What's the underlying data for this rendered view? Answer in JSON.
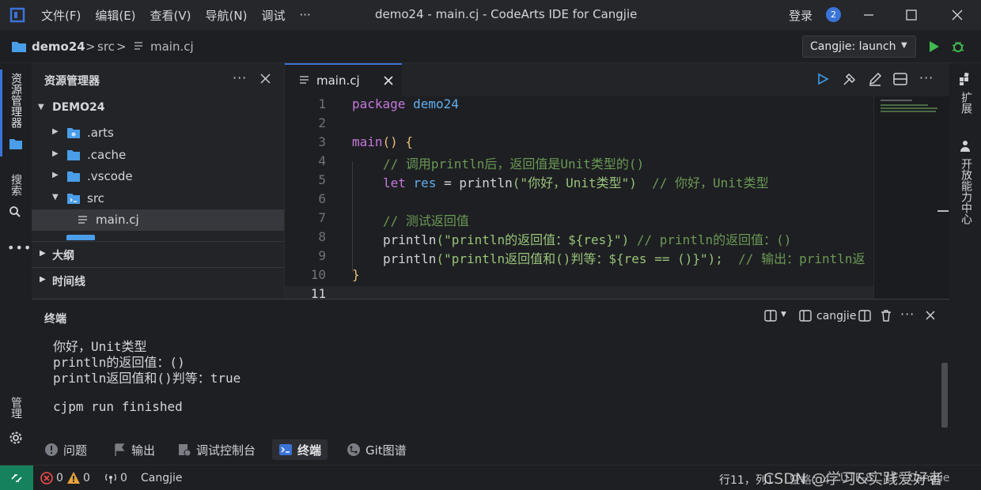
{
  "titlebar": {
    "menus": [
      "文件(F)",
      "编辑(E)",
      "查看(V)",
      "导航(N)",
      "调试",
      "···"
    ],
    "title": "demo24 - main.cj - CodeArts IDE for Cangjie",
    "login": "登录",
    "notification_count": "2"
  },
  "breadcrumb": {
    "project": "demo24",
    "folder": "src",
    "file": "main.cj",
    "sep": ">"
  },
  "launch": {
    "config": "Cangjie: launch"
  },
  "activity": {
    "explorer": "资源管理器",
    "search": "搜索",
    "manage": "管理"
  },
  "sidebar": {
    "title": "资源管理器",
    "root": "DEMO24",
    "items": [
      {
        "label": ".arts"
      },
      {
        "label": ".cache"
      },
      {
        "label": ".vscode"
      },
      {
        "label": "src"
      },
      {
        "label": "main.cj"
      }
    ],
    "outline": "大纲",
    "timeline": "时间线"
  },
  "editor": {
    "tab": "main.cj",
    "lines": [
      {
        "n": "1"
      },
      {
        "n": "2"
      },
      {
        "n": "3"
      },
      {
        "n": "4"
      },
      {
        "n": "5"
      },
      {
        "n": "6"
      },
      {
        "n": "7"
      },
      {
        "n": "8"
      },
      {
        "n": "9"
      },
      {
        "n": "10"
      },
      {
        "n": "11"
      }
    ],
    "code": {
      "l1_kw": "package",
      "l1_name": "demo24",
      "l3_fn": "main",
      "l3_rest": "() {",
      "l4": "// 调用println后，返回值是Unit类型的()",
      "l5_kw": "let",
      "l5_var": "res",
      "l5_eq": " = ",
      "l5_fn": "println",
      "l5_str": "(\"你好，Unit类型\")",
      "l5_cmt": "// 你好，Unit类型",
      "l7": "// 测试返回值",
      "l8_fn": "println",
      "l8_str": "(\"println的返回值：${res}\")",
      "l8_cmt": "// println的返回值：()",
      "l9_fn": "println",
      "l9_str": "(\"println返回值和()判等：${res == ()}\");",
      "l9_cmt": "// 输出：println返",
      "l10": "}"
    }
  },
  "panel": {
    "title": "终端",
    "terminal_name": "cangjie",
    "output": [
      "你好，Unit类型",
      "println的返回值：()",
      "println返回值和()判等：true",
      "",
      "cjpm run finished"
    ]
  },
  "panel_tabs": [
    {
      "label": "问题"
    },
    {
      "label": "输出"
    },
    {
      "label": "调试控制台"
    },
    {
      "label": "终端"
    },
    {
      "label": "Git图谱"
    }
  ],
  "rightbar": {
    "extensions": "扩展",
    "dev_center": "开放能力中心"
  },
  "statusbar": {
    "errors": "0",
    "warnings": "0",
    "ports": "0",
    "language": "Cangjie",
    "position": "行11，列1",
    "spaces": "空格：4",
    "encoding": "UTF-8",
    "eol": "LF",
    "lang_mode": "Cangjie",
    "watermark": "CSDN @学习&实践爱好者"
  },
  "colors": {
    "accent": "#3b74d9",
    "remote": "#16825d",
    "run": "#3fb950"
  }
}
